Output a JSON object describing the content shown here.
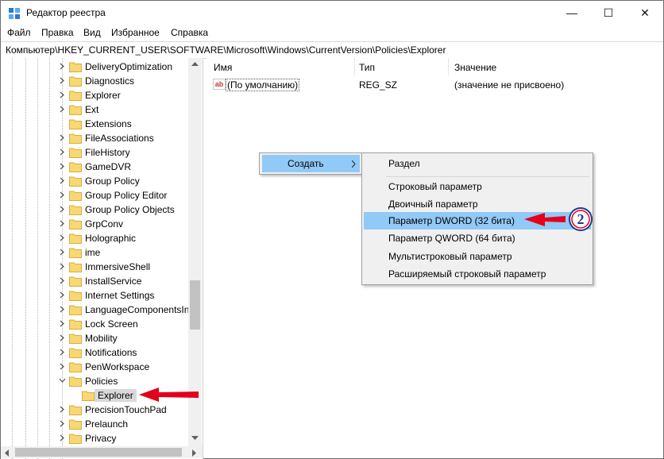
{
  "window": {
    "title": "Редактор реестра",
    "controls": {
      "minimize": "—",
      "maximize": "☐",
      "close": "✕"
    }
  },
  "menu": [
    "Файл",
    "Правка",
    "Вид",
    "Избранное",
    "Справка"
  ],
  "address": "Компьютер\\HKEY_CURRENT_USER\\SOFTWARE\\Microsoft\\Windows\\CurrentVersion\\Policies\\Explorer",
  "tree": {
    "items": [
      {
        "label": "DeliveryOptimization",
        "expander": "right"
      },
      {
        "label": "Diagnostics",
        "expander": "right"
      },
      {
        "label": "Explorer",
        "expander": "right"
      },
      {
        "label": "Ext",
        "expander": "right"
      },
      {
        "label": "Extensions",
        "expander": "none"
      },
      {
        "label": "FileAssociations",
        "expander": "right"
      },
      {
        "label": "FileHistory",
        "expander": "right"
      },
      {
        "label": "GameDVR",
        "expander": "right"
      },
      {
        "label": "Group Policy",
        "expander": "right"
      },
      {
        "label": "Group Policy Editor",
        "expander": "right"
      },
      {
        "label": "Group Policy Objects",
        "expander": "right"
      },
      {
        "label": "GrpConv",
        "expander": "right"
      },
      {
        "label": "Holographic",
        "expander": "right"
      },
      {
        "label": "ime",
        "expander": "right"
      },
      {
        "label": "ImmersiveShell",
        "expander": "right"
      },
      {
        "label": "InstallService",
        "expander": "right"
      },
      {
        "label": "Internet Settings",
        "expander": "right"
      },
      {
        "label": "LanguageComponentsIn",
        "expander": "right"
      },
      {
        "label": "Lock Screen",
        "expander": "right"
      },
      {
        "label": "Mobility",
        "expander": "right"
      },
      {
        "label": "Notifications",
        "expander": "right"
      },
      {
        "label": "PenWorkspace",
        "expander": "right"
      },
      {
        "label": "Policies",
        "expander": "down"
      },
      {
        "label": "Explorer",
        "expander": "none",
        "child": true,
        "selected": true
      },
      {
        "label": "PrecisionTouchPad",
        "expander": "right"
      },
      {
        "label": "Prelaunch",
        "expander": "right"
      },
      {
        "label": "Privacy",
        "expander": "right"
      }
    ]
  },
  "list": {
    "headers": {
      "name": "Имя",
      "type": "Тип",
      "value": "Значение"
    },
    "rows": [
      {
        "name": "(По умолчанию)",
        "type": "REG_SZ",
        "value": "(значение не присвоено)",
        "icon": "ab"
      }
    ]
  },
  "context_menu": {
    "create_label": "Создать",
    "submenu": [
      "Раздел",
      "Строковый параметр",
      "Двоичный параметр",
      "Параметр DWORD (32 бита)",
      "Параметр QWORD (64 бита)",
      "Мультистроковый параметр",
      "Расширяемый строковый параметр"
    ],
    "highlighted_index": 3
  },
  "annotation": {
    "badge": "2"
  },
  "colors": {
    "highlight": "#91c9f7",
    "selected_tree": "#d9d9d9",
    "folder": "#f8d775",
    "arrow": "#e3001b",
    "badge_border": "#1e3c8c"
  }
}
